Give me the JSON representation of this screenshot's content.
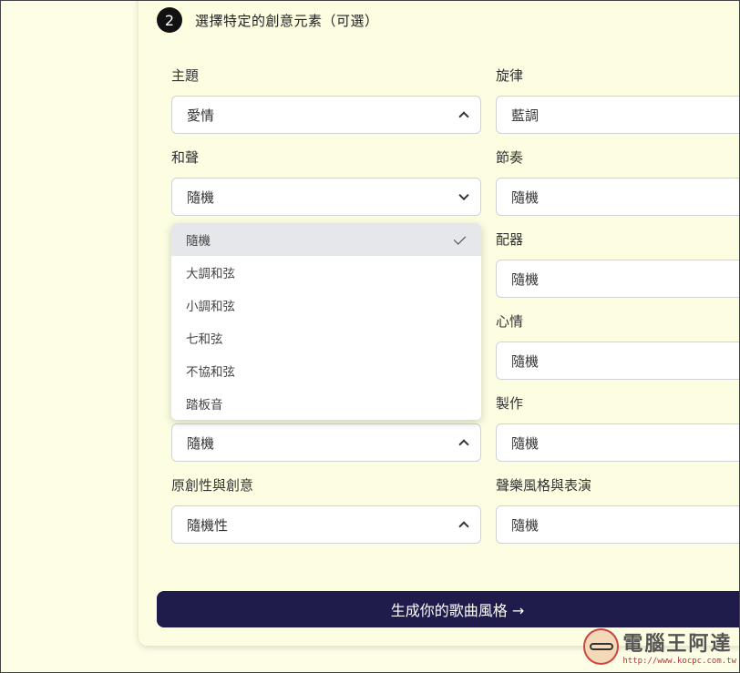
{
  "step": {
    "number": "2",
    "title": "選擇特定的創意元素（可選）"
  },
  "fields": {
    "theme": {
      "label": "主題",
      "value": "愛情"
    },
    "melody": {
      "label": "旋律",
      "value": "藍調"
    },
    "harmony": {
      "label": "和聲",
      "value": "隨機"
    },
    "rhythm": {
      "label": "節奏",
      "value": "隨機"
    },
    "orchestration": {
      "label": "配器",
      "value": "隨機"
    },
    "mood": {
      "label": "心情",
      "value": "隨機"
    },
    "hidden_left": {
      "value": "隨機"
    },
    "production": {
      "label": "製作",
      "value": "隨機"
    },
    "originality": {
      "label": "原創性與創意",
      "value": "隨機性"
    },
    "vocal_style": {
      "label": "聲樂風格與表演",
      "value": "隨機"
    }
  },
  "harmony_dropdown": {
    "options": [
      "隨機",
      "大調和弦",
      "小調和弦",
      "七和弦",
      "不協和弦",
      "踏板音"
    ],
    "selected": "隨機"
  },
  "generate_button": {
    "label": "生成你的歌曲風格 →"
  },
  "watermark": {
    "title": "電腦王阿達",
    "url": "http://www.kocpc.com.tw"
  }
}
